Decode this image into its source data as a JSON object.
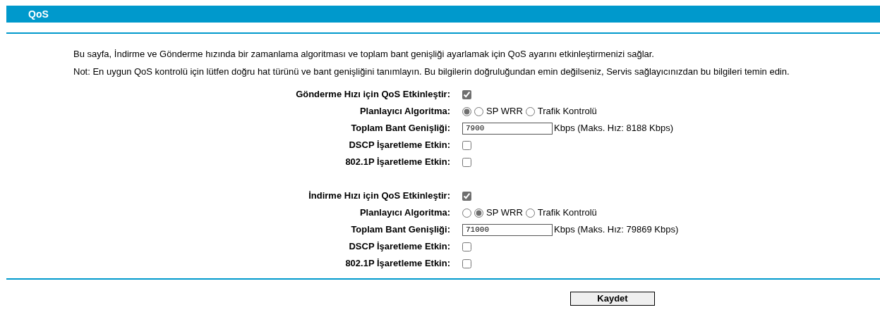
{
  "header": {
    "title": "QoS"
  },
  "description": [
    "Bu sayfa, İndirme ve Gönderme hızında bir zamanlama algoritması ve toplam bant genişliği ayarlamak için QoS ayarını etkinleştirmenizi sağlar.",
    "Not: En uygun QoS kontrolü için lütfen doğru hat türünü ve bant genişliğini tanımlayın. Bu bilgilerin doğruluğundan emin değilseniz, Servis sağlayıcınızdan bu bilgileri temin edin."
  ],
  "sections": [
    {
      "rows": [
        {
          "kind": "checkbox",
          "label": "Gönderme Hızı için QoS Etkinleştir:",
          "checked": true
        },
        {
          "kind": "radio",
          "label": "Planlayıcı Algoritma:",
          "options": [
            {
              "selected": true
            },
            {
              "label": "SP WRR",
              "selected": false
            },
            {
              "label": "Trafik Kontrolü",
              "selected": false
            }
          ]
        },
        {
          "kind": "input",
          "label": "Toplam Bant Genişliği:",
          "value": "7900",
          "suffix": "Kbps (Maks. Hız: 8188 Kbps)"
        },
        {
          "kind": "checkbox",
          "label": "DSCP İşaretleme Etkin:",
          "checked": false
        },
        {
          "kind": "checkbox",
          "label": "802.1P İşaretleme Etkin:",
          "checked": false
        }
      ]
    },
    {
      "rows": [
        {
          "kind": "checkbox",
          "label": "İndirme Hızı için QoS Etkinleştir:",
          "checked": true
        },
        {
          "kind": "radio",
          "label": "Planlayıcı Algoritma:",
          "options": [
            {
              "selected": false
            },
            {
              "label": "SP WRR",
              "selected": true
            },
            {
              "label": "Trafik Kontrolü",
              "selected": false
            }
          ]
        },
        {
          "kind": "input",
          "label": "Toplam Bant Genişliği:",
          "value": "71000",
          "suffix": "Kbps (Maks. Hız: 79869 Kbps)"
        },
        {
          "kind": "checkbox",
          "label": "DSCP İşaretleme Etkin:",
          "checked": false
        },
        {
          "kind": "checkbox",
          "label": "802.1P İşaretleme Etkin:",
          "checked": false
        }
      ]
    }
  ],
  "save_button": "Kaydet"
}
